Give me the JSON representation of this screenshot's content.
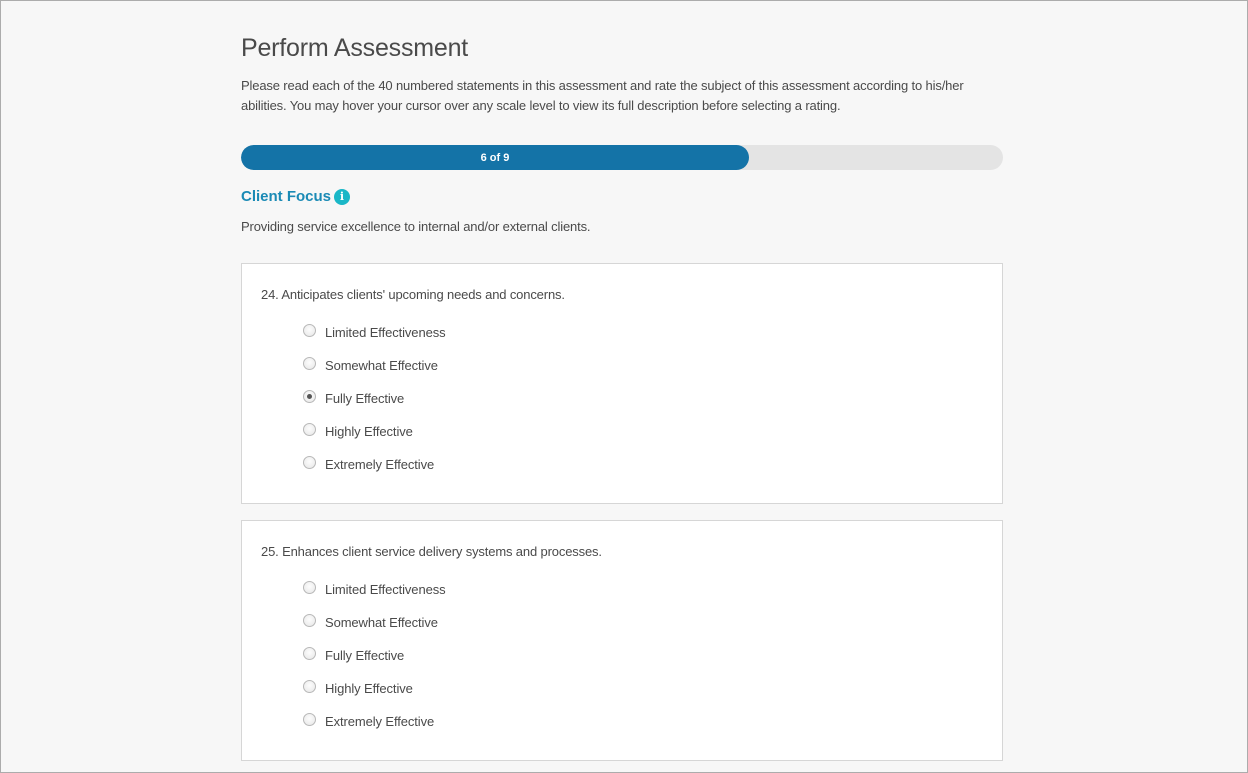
{
  "page": {
    "title": "Perform Assessment",
    "intro": "Please read each of the 40 numbered statements in this assessment and rate the subject of this assessment according to his/her abilities. You may hover your cursor over any scale level to view its full description before selecting a rating."
  },
  "progress": {
    "label": "6 of 9",
    "current": 6,
    "total": 9,
    "fill_color": "#1473a7"
  },
  "section": {
    "title": "Client Focus",
    "info_icon": "info-icon",
    "description": "Providing service excellence to internal and/or external clients."
  },
  "questions": [
    {
      "text": "24. Anticipates clients' upcoming needs and concerns.",
      "selected": "Fully Effective",
      "options": [
        {
          "label": "Limited Effectiveness",
          "checked": false
        },
        {
          "label": "Somewhat Effective",
          "checked": false
        },
        {
          "label": "Fully Effective",
          "checked": true
        },
        {
          "label": "Highly Effective",
          "checked": false
        },
        {
          "label": "Extremely Effective",
          "checked": false
        }
      ]
    },
    {
      "text": "25. Enhances client service delivery systems and processes.",
      "selected": null,
      "options": [
        {
          "label": "Limited Effectiveness",
          "checked": false
        },
        {
          "label": "Somewhat Effective",
          "checked": false
        },
        {
          "label": "Fully Effective",
          "checked": false
        },
        {
          "label": "Highly Effective",
          "checked": false
        },
        {
          "label": "Extremely Effective",
          "checked": false
        }
      ]
    }
  ]
}
